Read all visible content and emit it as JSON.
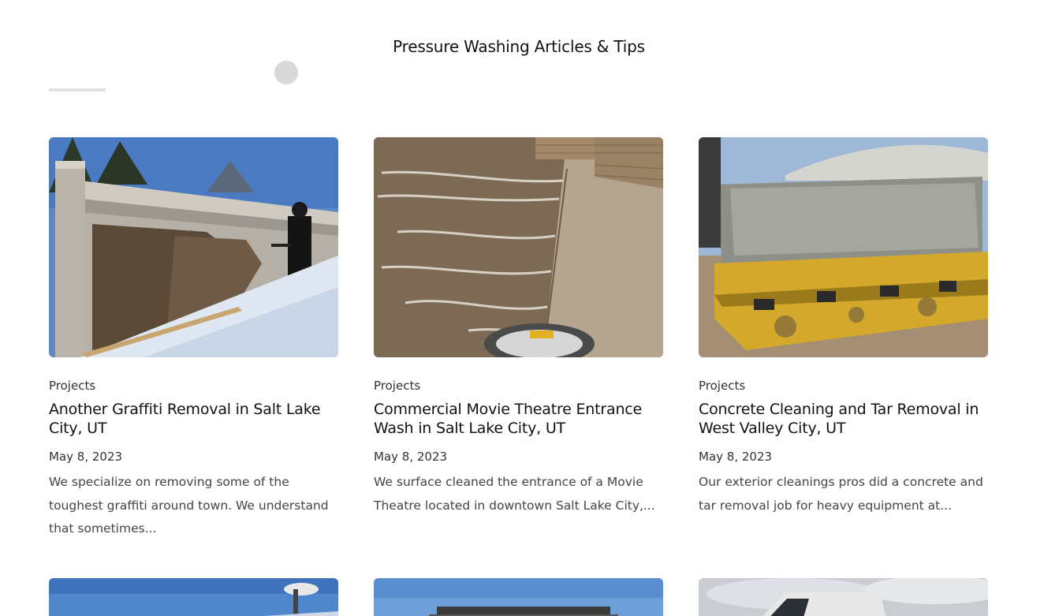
{
  "section": {
    "title": "Pressure Washing Articles & Tips"
  },
  "posts": [
    {
      "category": "Projects",
      "title": "Another Graffiti Removal in Salt Lake City, UT",
      "date": "May 8, 2023",
      "excerpt": "We specialize on removing some of the toughest graffiti around town. We understand that sometimes..."
    },
    {
      "category": "Projects",
      "title": "Commercial Movie Theatre Entrance Wash in Salt Lake City, UT",
      "date": "May 8, 2023",
      "excerpt": "We surface cleaned the entrance of a Movie Theatre located in downtown Salt Lake City,..."
    },
    {
      "category": "Projects",
      "title": "Concrete Cleaning and Tar Removal in West Valley City, UT",
      "date": "May 8, 2023",
      "excerpt": "Our exterior cleanings pros did a concrete and tar removal job for heavy equipment at..."
    }
  ]
}
